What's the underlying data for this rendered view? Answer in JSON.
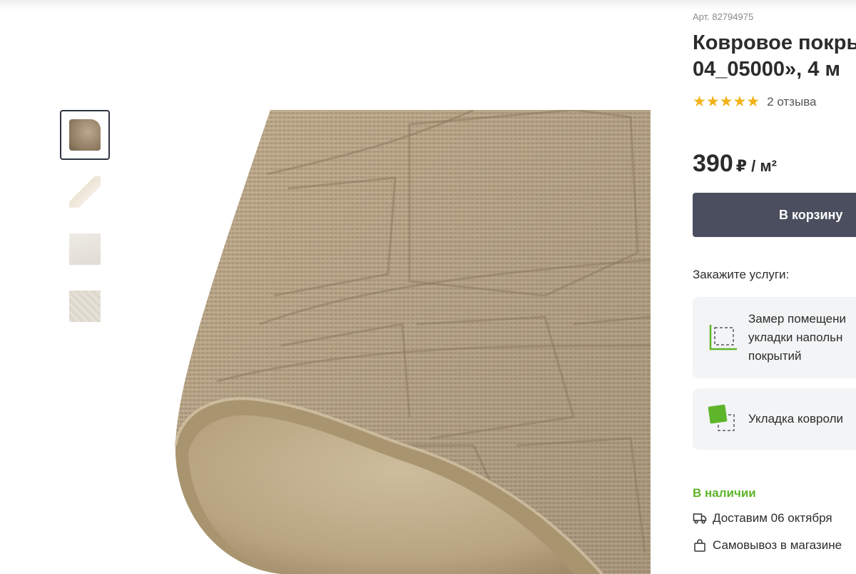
{
  "product": {
    "article": "Арт. 82794975",
    "title_line1": "Ковровое покры",
    "title_line2": "04_05000», 4 м",
    "stars": "★★★★★",
    "reviews": "2 отзыва",
    "price": "390",
    "price_unit": "₽ / м²",
    "cart_button": "В корзину",
    "services_title": "Закажите услуги:",
    "services": [
      {
        "lines": [
          "Замер помещени",
          "укладки напольн",
          "покрытий"
        ],
        "icon": "measure-icon"
      },
      {
        "lines": [
          "Укладка ковроли"
        ],
        "icon": "carpet-laying-icon"
      }
    ],
    "stock": "В наличии",
    "delivery": "Доставим 06 октября",
    "pickup": "Самовывоз в магазине"
  },
  "gallery": {
    "thumbnails": [
      "carpet-roll",
      "carpet-corner",
      "carpet-sample",
      "carpet-pattern"
    ],
    "active_index": 0
  },
  "colors": {
    "accent_green": "#5fb52a",
    "button_bg": "#4a4e5e",
    "star": "#f2b31a"
  }
}
